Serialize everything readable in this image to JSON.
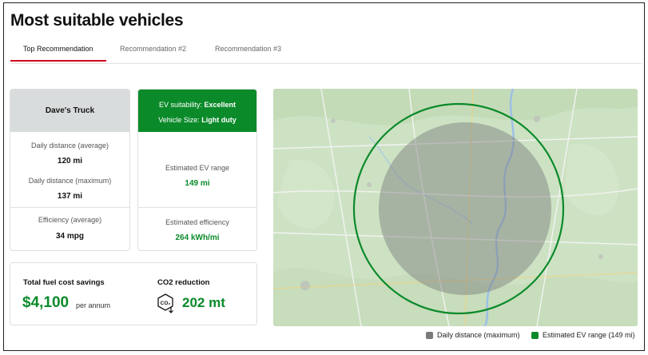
{
  "page": {
    "title": "Most suitable vehicles"
  },
  "tabs": [
    {
      "label": "Top Recommendation",
      "active": true
    },
    {
      "label": "Recommendation #2",
      "active": false
    },
    {
      "label": "Recommendation #3",
      "active": false
    }
  ],
  "vehicle_card": {
    "name": "Dave's Truck",
    "daily_avg_label": "Daily distance (average)",
    "daily_avg_value": "120 mi",
    "daily_max_label": "Daily distance (maximum)",
    "daily_max_value": "137 mi",
    "efficiency_label": "Efficiency (average)",
    "efficiency_value": "34 mpg"
  },
  "ev_card": {
    "suitability_label": "EV suitability:",
    "suitability_value": "Excellent",
    "size_label": "Vehicle Size:",
    "size_value": "Light duty",
    "range_label": "Estimated EV range",
    "range_value": "149 mi",
    "efficiency_label": "Estimated efficiency",
    "efficiency_value": "264 kWh/mi"
  },
  "savings_card": {
    "fuel_title": "Total fuel cost savings",
    "fuel_amount": "$4,100",
    "fuel_unit": "per annum",
    "co2_title": "CO2 reduction",
    "co2_icon_text": "CO₂",
    "co2_amount": "202 mt"
  },
  "legend": [
    {
      "label": "Daily distance (maximum)",
      "color": "#7a7a7a"
    },
    {
      "label": "Estimated EV range (149 mi)",
      "color": "#0b8a2a"
    }
  ],
  "colors": {
    "accent_red": "#d0021b",
    "green": "#0b8a2a",
    "grey_head": "#d9dcdc"
  },
  "icons": {
    "co2": "co2-down-icon"
  }
}
